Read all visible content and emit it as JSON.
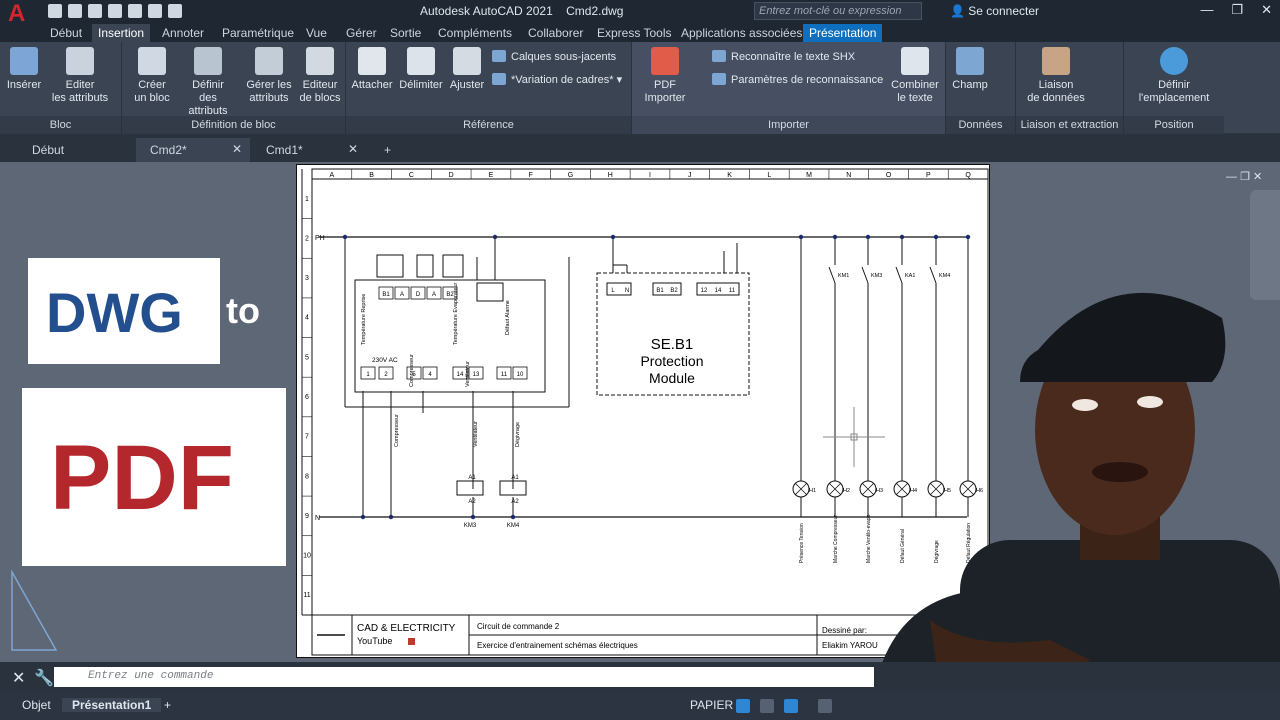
{
  "title": {
    "app": "Autodesk AutoCAD 2021",
    "file": "Cmd2.dwg",
    "search_placeholder": "Entrez mot-clé ou expression",
    "login": "Se connecter"
  },
  "tabs": [
    "Début",
    "Insertion",
    "Annoter",
    "Paramétrique",
    "Vue",
    "Gérer",
    "Sortie",
    "Compléments",
    "Collaborer",
    "Express Tools",
    "Applications associées",
    "Présentation"
  ],
  "ribbon": {
    "bloc": {
      "title": "Bloc",
      "inserer": "Insérer",
      "editer": "Editer\nles attributs"
    },
    "definition": {
      "title": "Définition de bloc",
      "creer": "Créer\nun bloc",
      "definir": "Définir\ndes attributs",
      "gerer": "Gérer les\nattributs",
      "editeur": "Editeur\nde blocs"
    },
    "reference": {
      "title": "Référence",
      "attacher": "Attacher",
      "delimiter": "Délimiter",
      "ajuster": "Ajuster",
      "calques": "Calques sous-jacents",
      "variation": "*Variation de cadres*"
    },
    "importer": {
      "title": "Importer",
      "pdf": "PDF\nImporter",
      "shx": "Reconnaître le texte SHX",
      "params": "Paramètres de reconnaissance",
      "combiner": "Combiner\nle texte"
    },
    "donnees": {
      "title": "Données",
      "champ": "Champ"
    },
    "liaison": {
      "title": "Liaison et extraction",
      "label": "Liaison\nde données"
    },
    "position": {
      "title": "Position",
      "definir": "Définir\nl'emplacement"
    }
  },
  "doc_tabs": [
    {
      "label": "Début"
    },
    {
      "label": "Cmd2*"
    },
    {
      "label": "Cmd1*"
    }
  ],
  "drawing": {
    "columns": [
      "A",
      "B",
      "C",
      "D",
      "E",
      "F",
      "G",
      "H",
      "I",
      "J",
      "K",
      "L",
      "M",
      "N",
      "O",
      "P",
      "Q"
    ],
    "rows": [
      "1",
      "2",
      "3",
      "4",
      "5",
      "6",
      "7",
      "8",
      "9",
      "10",
      "11"
    ],
    "rails": {
      "ph": "PH",
      "n": "N"
    },
    "module": {
      "title": "SE.B1",
      "line2": "Protection",
      "line3": "Module"
    },
    "module_terms": [
      "L",
      "N",
      "B1",
      "B2",
      "12",
      "14",
      "11"
    ],
    "left_terms": [
      "B1",
      "A",
      "D",
      "A",
      "B2"
    ],
    "left_bottom_terms": [
      "1",
      "2",
      "5",
      "4",
      "14",
      "13",
      "11",
      "10"
    ],
    "left_ac": "230V AC",
    "left_rot_labels": [
      "Température Reprise",
      "Température Evaporateur",
      "Défaut Alarme",
      "Compresseur",
      "Ventilateur"
    ],
    "lower_rot_labels": [
      "Compresseur",
      "Ventilateur",
      "Dégivrage"
    ],
    "coils": [
      "KM3",
      "KM4"
    ],
    "coil_terms": [
      "A1",
      "A2"
    ],
    "contacts": [
      "KM1",
      "KM3",
      "KA1",
      "KM4"
    ],
    "lamps": [
      "H1",
      "H2",
      "H3",
      "H4",
      "H5",
      "H6"
    ],
    "lamp_labels": [
      "Présence Tension",
      "Marche Compresseur",
      "Marche Ventilo-evapo",
      "Défaut Général",
      "Dégivrage",
      "Défaut Régulation"
    ],
    "titleblock": {
      "company": "CAD & ELECTRICITY",
      "youtube": "YouTube",
      "circuit": "Circuit de commande 2",
      "exercise": "Exercice d'entrainement schémas électriques",
      "drawn_label": "Dessiné par:",
      "author": "Eliakim YAROU"
    }
  },
  "overlay": {
    "dwg": "DWG",
    "to": "to",
    "pdf": "PDF"
  },
  "command": {
    "placeholder": "Entrez une commande"
  },
  "status": {
    "objet": "Objet",
    "presentation": "Présentation1",
    "papier": "PAPIER"
  }
}
